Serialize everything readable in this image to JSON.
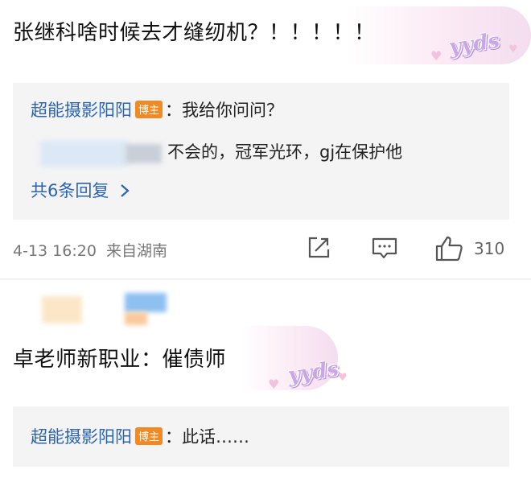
{
  "comments": [
    {
      "text": "张继科啥时候去才缝纫机？！！！！！",
      "sticker": "yyds",
      "replies": [
        {
          "user": "超能摄影阳阳",
          "badge": "博主",
          "text": "：我给你问问？"
        },
        {
          "text": "不会的，冠军光环，gj在保护他"
        }
      ],
      "more_label": "共6条回复",
      "time": "4-13 16:20",
      "location": "来自湖南",
      "like_count": "310"
    },
    {
      "text": "卓老师新职业：催债师",
      "sticker": "yyds",
      "replies": [
        {
          "user": "超能摄影阳阳",
          "badge": "博主",
          "text": "：此话……"
        }
      ]
    }
  ],
  "icons": [
    "share-icon",
    "comment-icon",
    "like-icon",
    "chevron-right-icon",
    "heart-icon"
  ],
  "colors": {
    "username": "#2b64b0",
    "badge": "#f08a24",
    "reply_bg": "#f4f4f5",
    "meta": "#777777"
  }
}
